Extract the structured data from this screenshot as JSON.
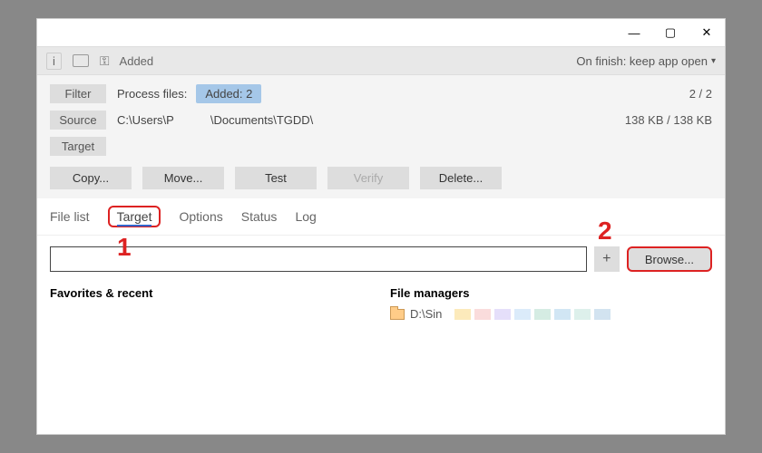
{
  "title_controls": {
    "minimize": "—",
    "maximize": "▢",
    "close": "✕"
  },
  "toolbar": {
    "status_label": "Added",
    "finish_label": "On finish: keep app open"
  },
  "filter": {
    "label": "Filter",
    "process_label": "Process files:",
    "added_pill": "Added: 2",
    "count": "2 / 2"
  },
  "source": {
    "label": "Source",
    "path_a": "C:\\Users\\P",
    "path_b": "\\Documents\\TGDD\\",
    "size": "138 KB / 138 KB"
  },
  "target_row": {
    "label": "Target"
  },
  "actions": {
    "copy": "Copy...",
    "move": "Move...",
    "test": "Test",
    "verify": "Verify",
    "delete": "Delete..."
  },
  "tabs": {
    "file_list": "File list",
    "target": "Target",
    "options": "Options",
    "status": "Status",
    "log": "Log"
  },
  "target_input": {
    "value": "",
    "placeholder": ""
  },
  "buttons": {
    "plus": "+",
    "browse": "Browse..."
  },
  "sections": {
    "favorites": "Favorites & recent",
    "managers": "File managers"
  },
  "fm_item": {
    "label": "D:\\Sin"
  },
  "stripe_colors": [
    "#f5c23b",
    "#f29b9b",
    "#b5a4f2",
    "#98c6f0",
    "#88c9b0",
    "#7cb8e0",
    "#9fd4c5",
    "#7eaed4"
  ],
  "markers": {
    "one": "1",
    "two": "2"
  }
}
